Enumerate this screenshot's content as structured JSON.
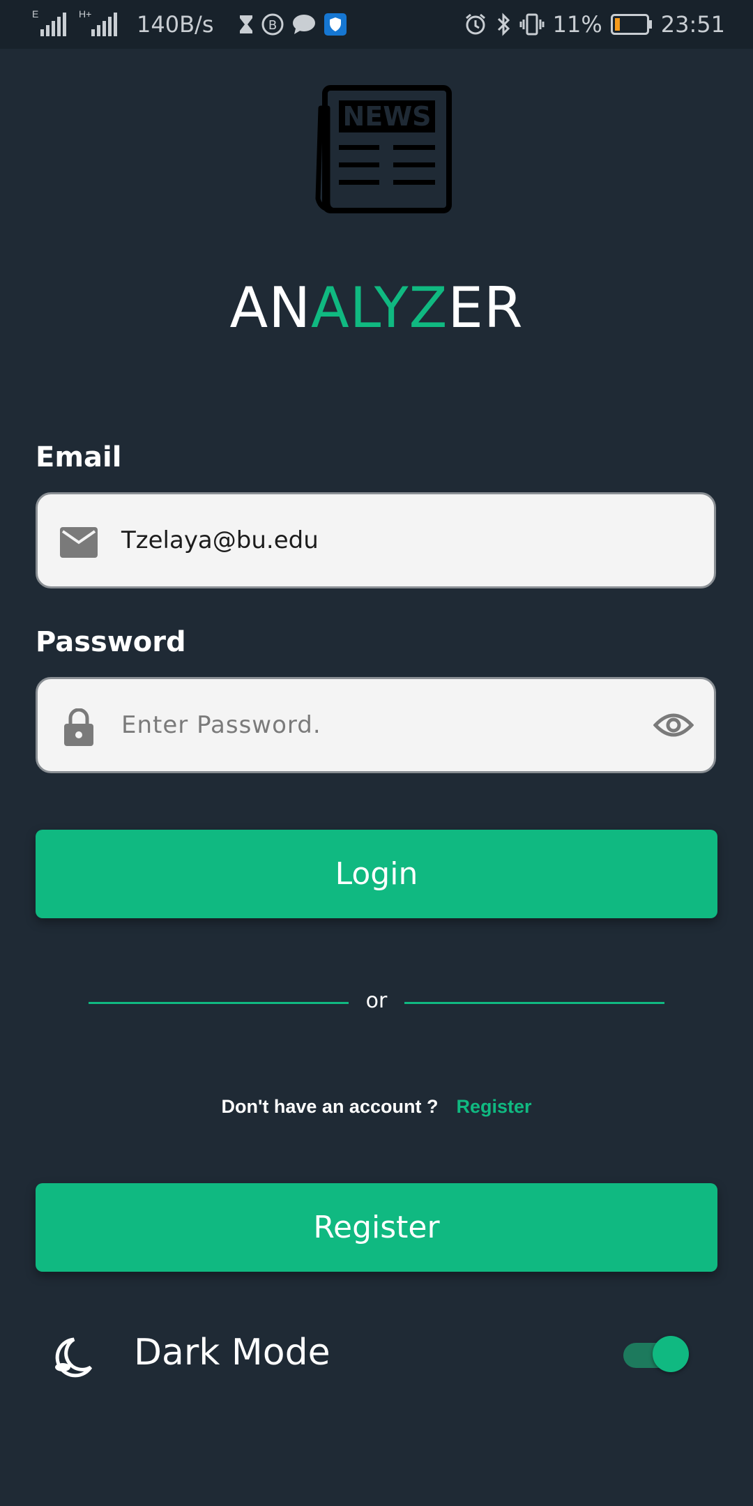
{
  "status_bar": {
    "network_1": "E",
    "network_2": "H+",
    "speed": "140B/s",
    "battery": "11%",
    "time": "23:51"
  },
  "brand": {
    "logo_text": "NEWS",
    "part1": "AN",
    "part2": "ALYZ",
    "part3": "ER",
    "accent_color": "#10b981"
  },
  "email": {
    "label": "Email",
    "value": "Tzelaya@bu.edu"
  },
  "password": {
    "label": "Password",
    "placeholder": "Enter Password."
  },
  "login_button": "Login",
  "separator": "or",
  "signup": {
    "prompt": "Don't have an account ?",
    "link": "Register"
  },
  "register_button": "Register",
  "dark_mode": {
    "label": "Dark Mode",
    "enabled": true
  }
}
